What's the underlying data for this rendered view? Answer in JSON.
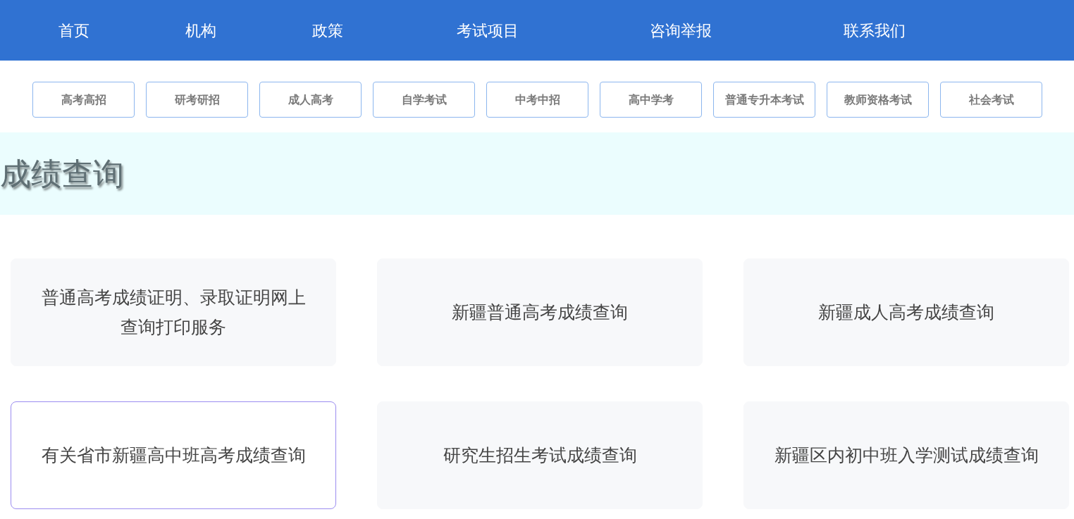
{
  "nav": [
    {
      "label": "首页"
    },
    {
      "label": "机构"
    },
    {
      "label": "政策"
    },
    {
      "label": "考试项目"
    },
    {
      "label": "咨询举报"
    },
    {
      "label": "联系我们"
    }
  ],
  "categories": [
    "高考高招",
    "研考研招",
    "成人高考",
    "自学考试",
    "中考中招",
    "高中学考",
    "普通专升本考试",
    "教师资格考试",
    "社会考试"
  ],
  "banner": {
    "title": "成绩查询"
  },
  "cards": [
    {
      "label": "普通高考成绩证明、录取证明网上查询打印服务",
      "highlighted": false
    },
    {
      "label": "新疆普通高考成绩查询",
      "highlighted": false
    },
    {
      "label": "新疆成人高考成绩查询",
      "highlighted": false
    },
    {
      "label": "有关省市新疆高中班高考成绩查询",
      "highlighted": true
    },
    {
      "label": "研究生招生考试成绩查询",
      "highlighted": false
    },
    {
      "label": "新疆区内初中班入学测试成绩查询",
      "highlighted": false
    }
  ]
}
